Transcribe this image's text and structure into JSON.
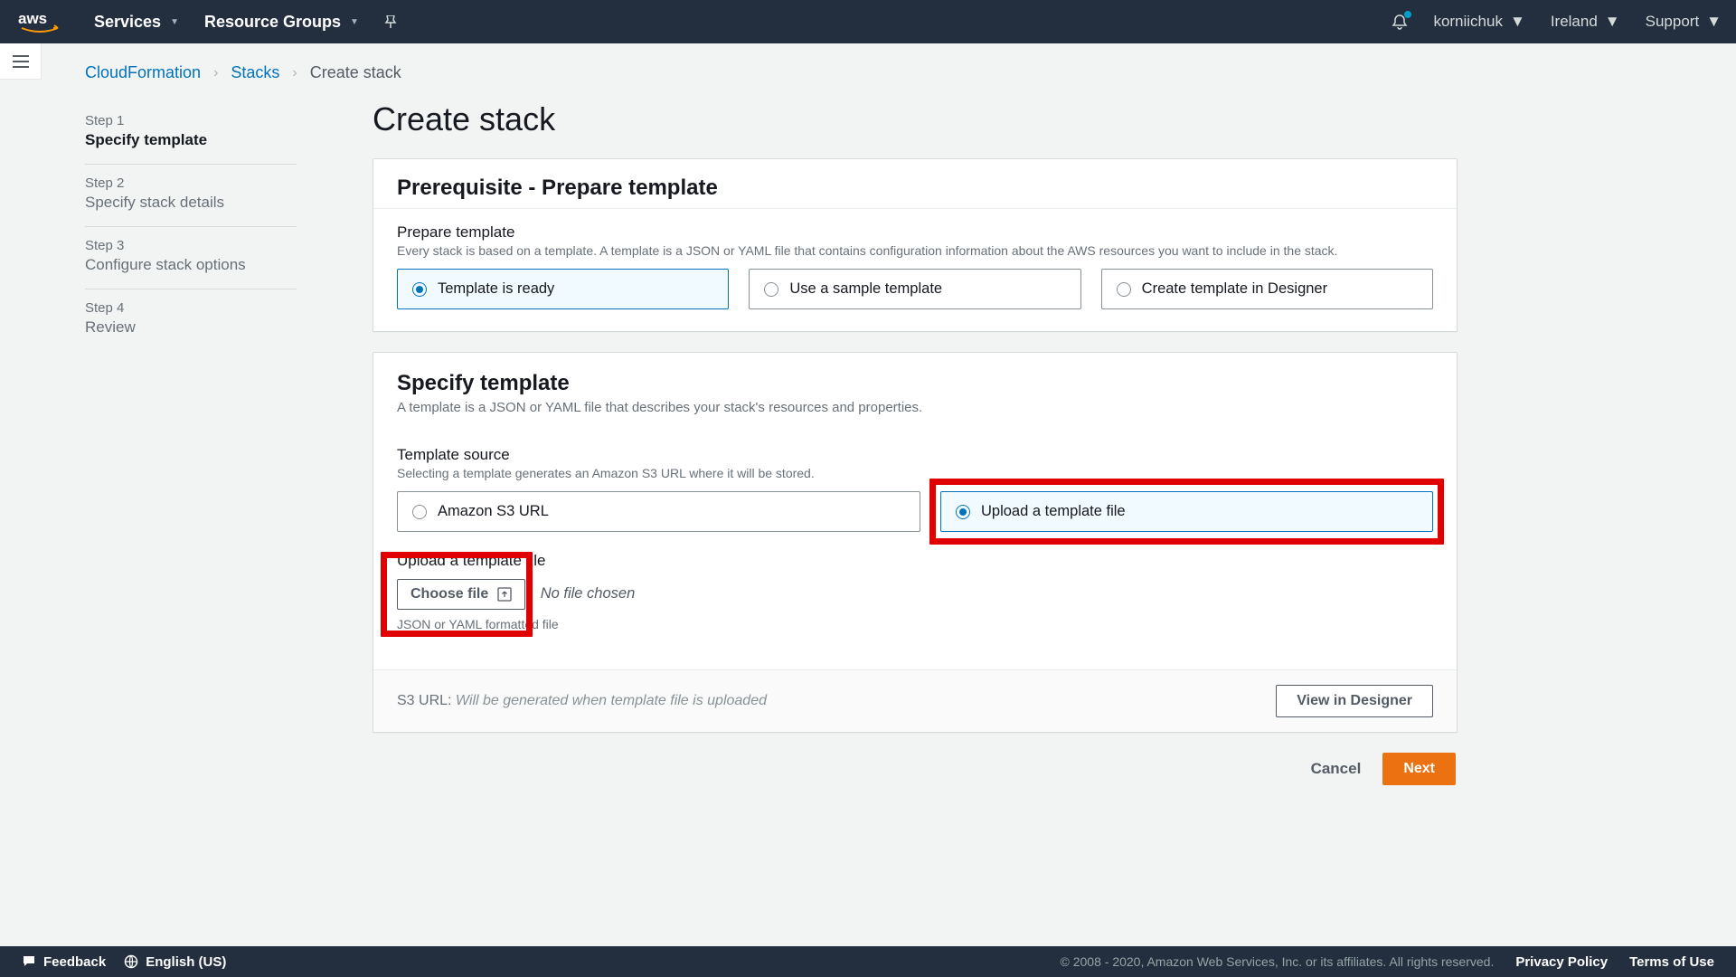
{
  "topnav": {
    "services": "Services",
    "resource_groups": "Resource Groups",
    "user": "korniichuk",
    "region": "Ireland",
    "support": "Support"
  },
  "breadcrumbs": {
    "cloudformation": "CloudFormation",
    "stacks": "Stacks",
    "create": "Create stack"
  },
  "steps": [
    {
      "num": "Step 1",
      "name": "Specify template"
    },
    {
      "num": "Step 2",
      "name": "Specify stack details"
    },
    {
      "num": "Step 3",
      "name": "Configure stack options"
    },
    {
      "num": "Step 4",
      "name": "Review"
    }
  ],
  "page_title": "Create stack",
  "prereq": {
    "heading": "Prerequisite - Prepare template",
    "field_label": "Prepare template",
    "field_desc": "Every stack is based on a template. A template is a JSON or YAML file that contains configuration information about the AWS resources you want to include in the stack.",
    "options": [
      "Template is ready",
      "Use a sample template",
      "Create template in Designer"
    ]
  },
  "specify": {
    "heading": "Specify template",
    "sub": "A template is a JSON or YAML file that describes your stack's resources and properties.",
    "source_label": "Template source",
    "source_desc": "Selecting a template generates an Amazon S3 URL where it will be stored.",
    "options": [
      "Amazon S3 URL",
      "Upload a template file"
    ],
    "upload_label": "Upload a template file",
    "choose_file": "Choose file",
    "no_file": "No file chosen",
    "hint": "JSON or YAML formatted file",
    "s3url_label": "S3 URL:",
    "s3url_pending": "Will be generated when template file is uploaded",
    "view_designer": "View in Designer"
  },
  "actions": {
    "cancel": "Cancel",
    "next": "Next"
  },
  "footer": {
    "feedback": "Feedback",
    "language": "English (US)",
    "copyright": "© 2008 - 2020, Amazon Web Services, Inc. or its affiliates. All rights reserved.",
    "privacy": "Privacy Policy",
    "terms": "Terms of Use"
  }
}
